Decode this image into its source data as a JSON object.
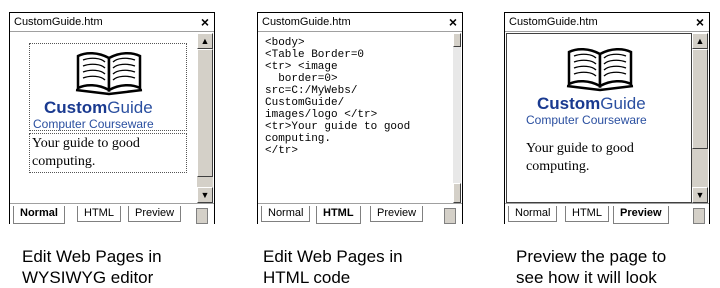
{
  "panels": [
    {
      "title": "CustomGuide.htm",
      "close": "×",
      "tabs": [
        "Normal",
        "HTML",
        "Preview"
      ],
      "active_tab": "Normal",
      "logo": {
        "word_bold": "Custom",
        "word_light": "Guide",
        "sub": "Computer Courseware"
      },
      "body_text": [
        "Your guide to good",
        "computing."
      ],
      "caption": [
        "Edit Web Pages in",
        "WYSIWYG editor"
      ]
    },
    {
      "title": "CustomGuide.htm",
      "close": "×",
      "tabs": [
        "Normal",
        "HTML",
        "Preview"
      ],
      "active_tab": "HTML",
      "code": "<body>\n<Table Border=0\n<tr> <image\n  border=0>\nsrc=C:/MyWebs/\nCustomGuide/\nimages/logo </tr>\n<tr>Your guide to good\ncomputing.\n</tr>",
      "caption": [
        "Edit Web Pages in",
        "HTML code"
      ]
    },
    {
      "title": "CustomGuide.htm",
      "close": "×",
      "tabs": [
        "Normal",
        "HTML",
        "Preview"
      ],
      "active_tab": "Preview",
      "logo": {
        "word_bold": "Custom",
        "word_light": "Guide",
        "sub": "Computer Courseware"
      },
      "body_text": [
        "Your guide to good",
        "computing."
      ],
      "caption": [
        "Preview the page to",
        "see how it will look"
      ]
    }
  ],
  "scroll_arrows": {
    "up": "▲",
    "down": "▼"
  }
}
